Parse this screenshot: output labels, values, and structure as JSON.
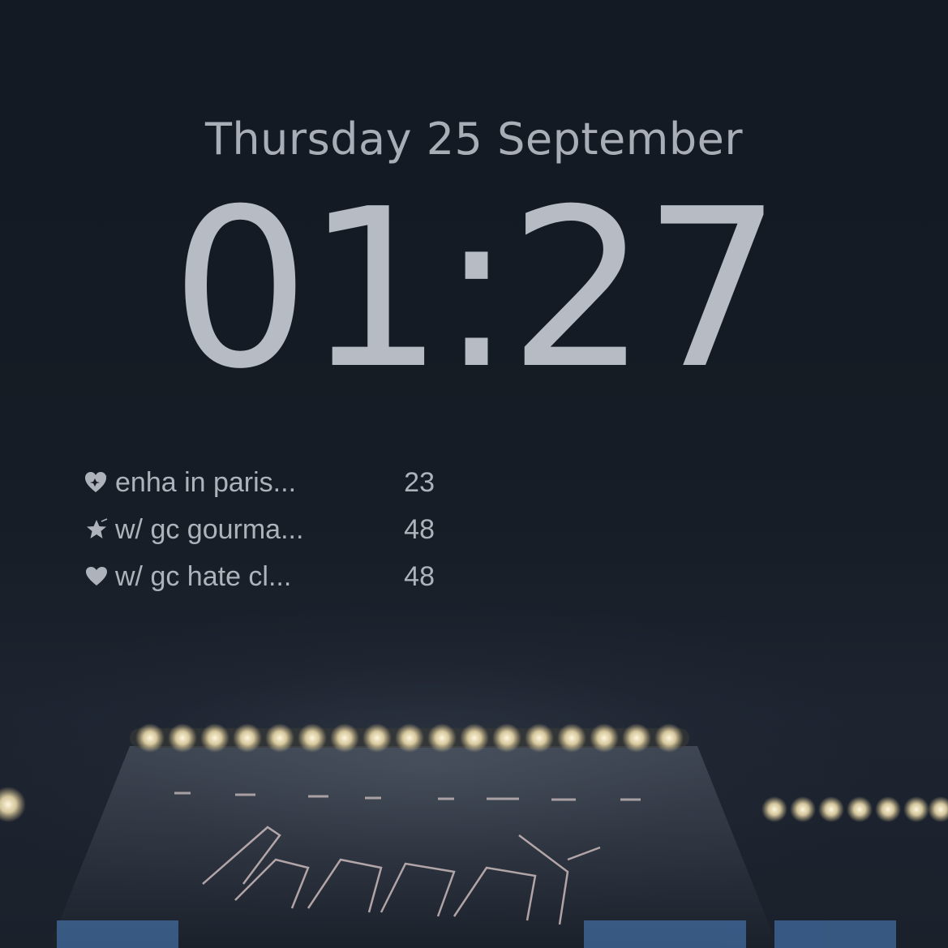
{
  "lockscreen": {
    "date": "Thursday 25 September",
    "time": "01:27"
  },
  "widget": {
    "items": [
      {
        "icon": "heart-sparkle-icon",
        "label": "enha in paris...",
        "count": "23"
      },
      {
        "icon": "shooting-star-icon",
        "label": "w/ gc gourma...",
        "count": "48"
      },
      {
        "icon": "heart-icon",
        "label": "w/ gc hate cl...",
        "count": "48"
      }
    ]
  },
  "colors": {
    "text": "#aeb2ba",
    "background": "#151b24"
  }
}
